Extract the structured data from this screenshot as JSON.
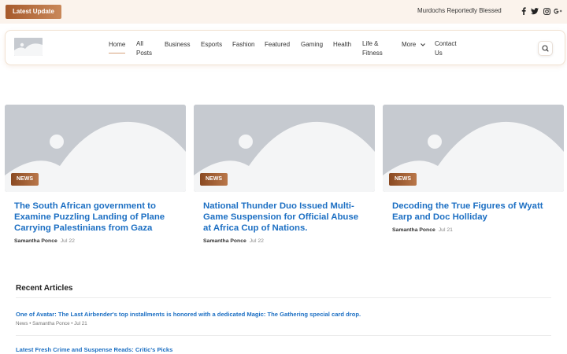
{
  "topbar": {
    "latest_label": "Latest Update",
    "ticker_text": "Murdochs Reportedly Blessed",
    "social_icons": [
      "facebook-icon",
      "twitter-icon",
      "instagram-icon",
      "google-plus-icon"
    ]
  },
  "nav": {
    "items": [
      {
        "label": "Home",
        "active": true
      },
      {
        "label": "All\nPosts"
      },
      {
        "label": "Business"
      },
      {
        "label": "Esports"
      },
      {
        "label": "Fashion"
      },
      {
        "label": "Featured"
      },
      {
        "label": "Gaming"
      },
      {
        "label": "Health"
      },
      {
        "label": "Life &\nFitness"
      },
      {
        "label": "More"
      },
      {
        "label": "Contact\nUs"
      }
    ]
  },
  "cards": [
    {
      "badge": "NEWS",
      "title": "The South African government to Examine Puzzling Landing of Plane Carrying Palestinians from Gaza",
      "author": "Samantha Ponce",
      "date": "Jul 22"
    },
    {
      "badge": "NEWS",
      "title": "National Thunder Duo Issued Multi-Game Suspension for Official Abuse at Africa Cup of Nations.",
      "author": "Samantha Ponce",
      "date": "Jul 22"
    },
    {
      "badge": "NEWS",
      "title": "Decoding the True Figures of Wyatt Earp and Doc Holliday",
      "author": "Samantha Ponce",
      "date": "Jul 21"
    }
  ],
  "recent": {
    "heading": "Recent Articles",
    "items": [
      {
        "title": "One of Avatar: The Last Airbender's top installments is honored with a dedicated Magic: The Gathering special card drop.",
        "meta": "News • Samantha Ponce • Jul 21"
      },
      {
        "title": "Latest Fresh Crime and Suspense Reads: Critic's Picks",
        "meta": ""
      }
    ]
  },
  "colors": {
    "accent": "#b9774a",
    "link": "#1c6fc3",
    "placeholder": "#c6cad0",
    "topbar_bg": "#fbf3ec"
  }
}
